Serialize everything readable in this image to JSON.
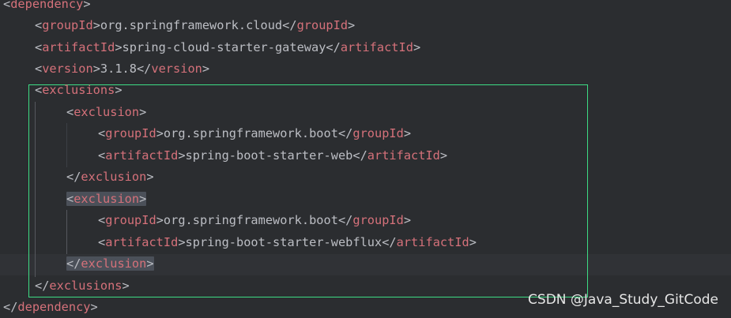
{
  "editor": {
    "language": "xml",
    "lines": [
      {
        "open": "<",
        "tag": "dependency",
        "close": ">"
      },
      {
        "open": "<",
        "tag": "groupId",
        "close": ">",
        "text": "org.springframework.cloud",
        "end_open": "</",
        "end_tag": "groupId",
        "end_close": ">"
      },
      {
        "open": "<",
        "tag": "artifactId",
        "close": ">",
        "text": "spring-cloud-starter-gateway",
        "end_open": "</",
        "end_tag": "artifactId",
        "end_close": ">"
      },
      {
        "open": "<",
        "tag": "version",
        "close": ">",
        "text": "3.1.8",
        "end_open": "</",
        "end_tag": "version",
        "end_close": ">"
      },
      {
        "open": "<",
        "tag": "exclusions",
        "close": ">"
      },
      {
        "open": "<",
        "tag": "exclusion",
        "close": ">"
      },
      {
        "open": "<",
        "tag": "groupId",
        "close": ">",
        "text": "org.springframework.boot",
        "end_open": "</",
        "end_tag": "groupId",
        "end_close": ">"
      },
      {
        "open": "<",
        "tag": "artifactId",
        "close": ">",
        "text": "spring-boot-starter-web",
        "end_open": "</",
        "end_tag": "artifactId",
        "end_close": ">"
      },
      {
        "open": "</",
        "tag": "exclusion",
        "close": ">"
      },
      {
        "open": "<",
        "tag": "exclusion",
        "close": ">"
      },
      {
        "open": "<",
        "tag": "groupId",
        "close": ">",
        "text": "org.springframework.boot",
        "end_open": "</",
        "end_tag": "groupId",
        "end_close": ">"
      },
      {
        "open": "<",
        "tag": "artifactId",
        "close": ">",
        "text": "spring-boot-starter-webflux",
        "end_open": "</",
        "end_tag": "artifactId",
        "end_close": ">"
      },
      {
        "open": "</",
        "tag": "exclusion",
        "close": ">"
      },
      {
        "open": "</",
        "tag": "exclusions",
        "close": ">"
      },
      {
        "open": "</",
        "tag": "dependency",
        "close": ">"
      }
    ]
  },
  "watermark": "CSDN @Java_Study_GitCode",
  "colors": {
    "background": "#2b2d30",
    "tag": "#d5717a",
    "text": "#bcbec4",
    "highlight": "#4b5059",
    "selection_border": "#3ddc84"
  }
}
